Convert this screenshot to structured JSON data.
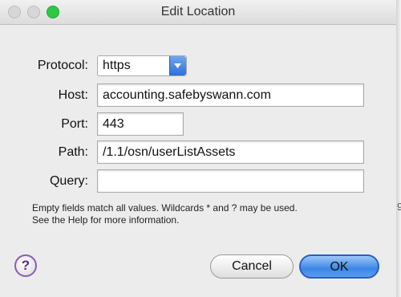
{
  "window": {
    "title": "Edit Location"
  },
  "form": {
    "protocol_label": "Protocol:",
    "protocol_value": "https",
    "host_label": "Host:",
    "host_value": "accounting.safebyswann.com",
    "port_label": "Port:",
    "port_value": "443",
    "path_label": "Path:",
    "path_value": "/1.1/osn/userListAssets",
    "query_label": "Query:",
    "query_value": ""
  },
  "hint": {
    "line1": "Empty fields match all values. Wildcards * and ? may be used.",
    "line2": "See the Help for more information."
  },
  "buttons": {
    "help": "?",
    "cancel": "Cancel",
    "ok": "OK"
  },
  "edge_mark": "9",
  "icons": {
    "select_arrow": "chevron-down-icon",
    "help": "help-icon"
  },
  "colors": {
    "ok_button": "#3d86e6",
    "help_ring": "#8f5bb3"
  }
}
